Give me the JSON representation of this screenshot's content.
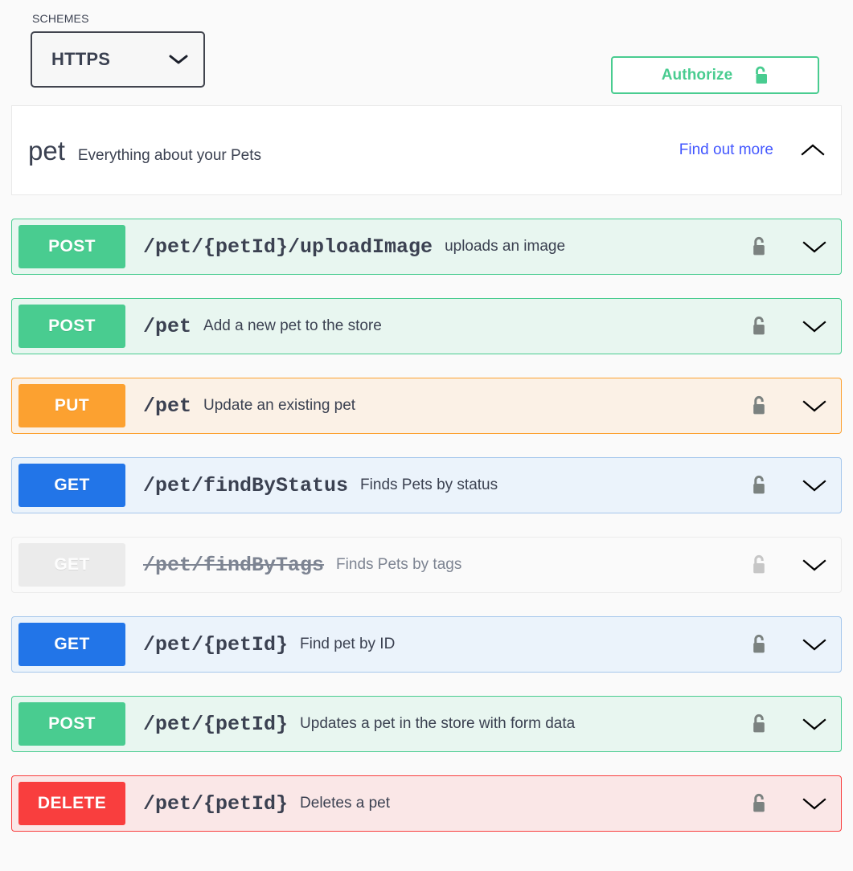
{
  "schemes": {
    "label": "SCHEMES",
    "selected": "HTTPS",
    "options": [
      "HTTPS"
    ],
    "chevron_icon": "chevron-down-icon"
  },
  "authorize": {
    "label": "Authorize",
    "icon": "unlock-icon",
    "color": "#49cc90"
  },
  "tag": {
    "name": "pet",
    "description": "Everything about your Pets",
    "external_docs_label": "Find out more",
    "external_docs_color": "#4357ff",
    "toggle_icon": "chevron-up-icon",
    "expanded": true
  },
  "operations": [
    {
      "method": "POST",
      "path": "/pet/{petId}/uploadImage",
      "summary": "uploads an image",
      "theme": "post",
      "color": "#49cc90",
      "deprecated": false,
      "lock_icon": "unlock-icon",
      "toggle_icon": "chevron-down-icon"
    },
    {
      "method": "POST",
      "path": "/pet",
      "summary": "Add a new pet to the store",
      "theme": "post",
      "color": "#49cc90",
      "deprecated": false,
      "lock_icon": "unlock-icon",
      "toggle_icon": "chevron-down-icon"
    },
    {
      "method": "PUT",
      "path": "/pet",
      "summary": "Update an existing pet",
      "theme": "put",
      "color": "#fca130",
      "deprecated": false,
      "lock_icon": "unlock-icon",
      "toggle_icon": "chevron-down-icon"
    },
    {
      "method": "GET",
      "path": "/pet/findByStatus",
      "summary": "Finds Pets by status",
      "theme": "get",
      "color": "#2275e8",
      "deprecated": false,
      "lock_icon": "unlock-icon",
      "toggle_icon": "chevron-down-icon"
    },
    {
      "method": "GET",
      "path": "/pet/findByTags",
      "summary": "Finds Pets by tags",
      "theme": "get",
      "color": "#ebebeb",
      "deprecated": true,
      "lock_icon": "unlock-icon",
      "toggle_icon": "chevron-down-icon"
    },
    {
      "method": "GET",
      "path": "/pet/{petId}",
      "summary": "Find pet by ID",
      "theme": "get",
      "color": "#2275e8",
      "deprecated": false,
      "lock_icon": "unlock-icon",
      "toggle_icon": "chevron-down-icon"
    },
    {
      "method": "POST",
      "path": "/pet/{petId}",
      "summary": "Updates a pet in the store with form data",
      "theme": "post",
      "color": "#49cc90",
      "deprecated": false,
      "lock_icon": "unlock-icon",
      "toggle_icon": "chevron-down-icon"
    },
    {
      "method": "DELETE",
      "path": "/pet/{petId}",
      "summary": "Deletes a pet",
      "theme": "delete",
      "color": "#f93e3e",
      "deprecated": false,
      "lock_icon": "unlock-icon",
      "toggle_icon": "chevron-down-icon"
    }
  ]
}
